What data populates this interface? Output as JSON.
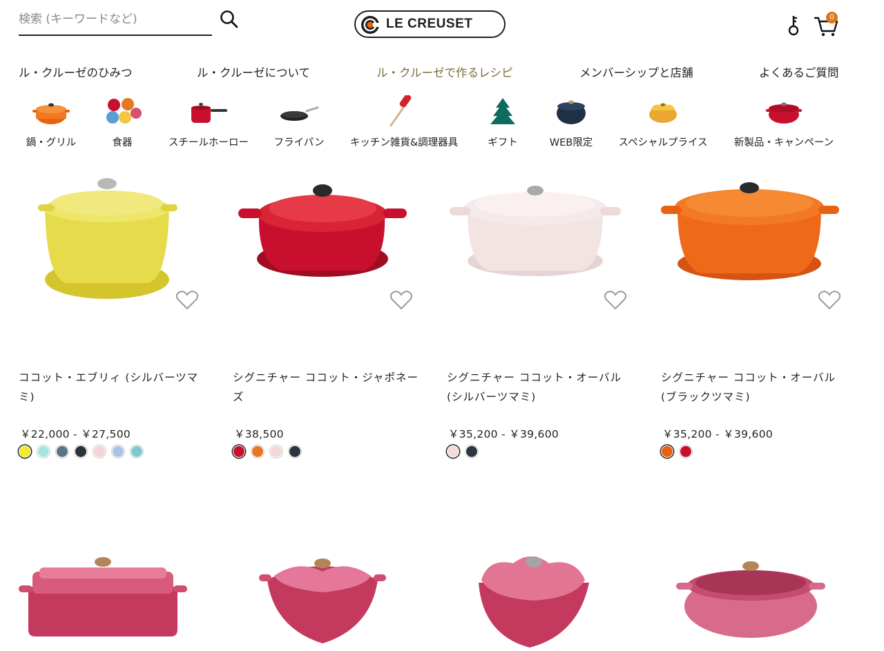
{
  "header": {
    "search_placeholder": "検索 (キーワードなど)",
    "logo_text": "LE CREUSET",
    "cart_count": "0"
  },
  "main_nav": [
    {
      "label": "ル・クルーゼのひみつ"
    },
    {
      "label": "ル・クルーゼについて"
    },
    {
      "label": "ル・クルーゼで作るレシピ"
    },
    {
      "label": "メンバーシップと店舗"
    },
    {
      "label": "よくあるご質問"
    }
  ],
  "categories": [
    {
      "label": "鍋・グリル",
      "icon": "pot-icon"
    },
    {
      "label": "食器",
      "icon": "plates-icon"
    },
    {
      "label": "スチールホーロー",
      "icon": "saucepan-icon"
    },
    {
      "label": "フライパン",
      "icon": "frying-pan-icon"
    },
    {
      "label": "キッチン雑貨&調理器具",
      "icon": "spatula-icon"
    },
    {
      "label": "ギフト",
      "icon": "tree-dish-icon"
    },
    {
      "label": "WEB限定",
      "icon": "navy-pot-icon"
    },
    {
      "label": "スペシャルプライス",
      "icon": "flower-pot-icon"
    },
    {
      "label": "新製品・キャンペーン",
      "icon": "red-pot-icon"
    }
  ],
  "products": [
    {
      "name": "ココット・エブリィ (シルバーツマミ)",
      "price": "￥22,000 - ￥27,500",
      "colors": [
        "#f2ea2e",
        "#a5e6dc",
        "#5d7283",
        "#2d3138",
        "#f4d3d6",
        "#a6c5e8",
        "#7fc8d0"
      ]
    },
    {
      "name": "シグニチャー ココット・ジャポネーズ",
      "price": "￥38,500",
      "colors": [
        "#c8102e",
        "#e87722",
        "#f2d8d8",
        "#2e3440"
      ]
    },
    {
      "name": "シグニチャー ココット・オーバル (シルバーツマミ)",
      "price": "￥35,200 - ￥39,600",
      "colors": [
        "#f3dcdc",
        "#2e3440"
      ]
    },
    {
      "name": "シグニチャー ココット・オーバル (ブラックツマミ)",
      "price": "￥35,200 - ￥39,600",
      "colors": [
        "#e8620f",
        "#c8102e"
      ]
    },
    {
      "name": "",
      "price": "",
      "colors": []
    },
    {
      "name": "",
      "price": "",
      "colors": []
    },
    {
      "name": "",
      "price": "",
      "colors": []
    },
    {
      "name": "",
      "price": "",
      "colors": []
    }
  ]
}
